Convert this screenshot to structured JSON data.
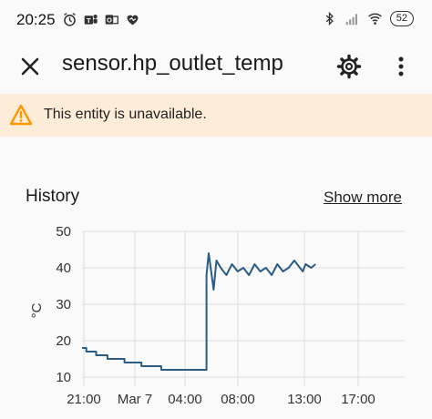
{
  "status_bar": {
    "time": "20:25",
    "battery": "52"
  },
  "app_bar": {
    "title": "sensor.hp_outlet_temp"
  },
  "warning": {
    "text": "This entity is unavailable."
  },
  "history": {
    "title": "History",
    "show_more": "Show more"
  },
  "colors": {
    "line": "#2b5c86",
    "warning_bg": "#fdecd8",
    "warning_icon": "#ff9800",
    "grid": "#dedede"
  },
  "icons": [
    "alarm-icon",
    "teams-icon",
    "outlook-icon",
    "heart-icon",
    "bluetooth-icon",
    "signal-icon",
    "wifi-icon",
    "battery-icon",
    "close-icon",
    "gear-icon",
    "more-vert-icon",
    "warning-icon"
  ],
  "chart_data": {
    "type": "line",
    "title": "",
    "ylabel": "°C",
    "ylim": [
      10,
      50
    ],
    "yticks": [
      "50",
      "40",
      "30",
      "20",
      "10"
    ],
    "xticks": [
      "21:00",
      "Mar 7",
      "04:00",
      "08:00",
      "13:00",
      "17:00"
    ],
    "grid": true,
    "series": [
      {
        "x": [
          21.0,
          21.3,
          21.3,
          22.0,
          22.0,
          22.8,
          22.8,
          24.0,
          24.0,
          25.2,
          25.2,
          26.6,
          26.6,
          28.0,
          28.0,
          29.8,
          29.8,
          29.95,
          30.3,
          30.5,
          30.8,
          31.2,
          31.6,
          32.0,
          32.4,
          32.8,
          33.2,
          33.6,
          34.0,
          34.4,
          34.8,
          35.2,
          35.6,
          36.0,
          36.4,
          36.6,
          36.8,
          37.2,
          37.5
        ],
        "y": [
          18,
          18,
          17,
          17,
          16,
          16,
          15,
          15,
          14,
          14,
          13,
          13,
          12,
          12,
          12,
          12,
          38,
          44,
          34,
          42,
          40,
          38,
          41,
          39,
          40,
          38,
          41,
          39,
          40,
          38,
          41,
          39,
          40,
          42,
          40,
          39,
          41,
          40,
          41
        ]
      }
    ]
  }
}
